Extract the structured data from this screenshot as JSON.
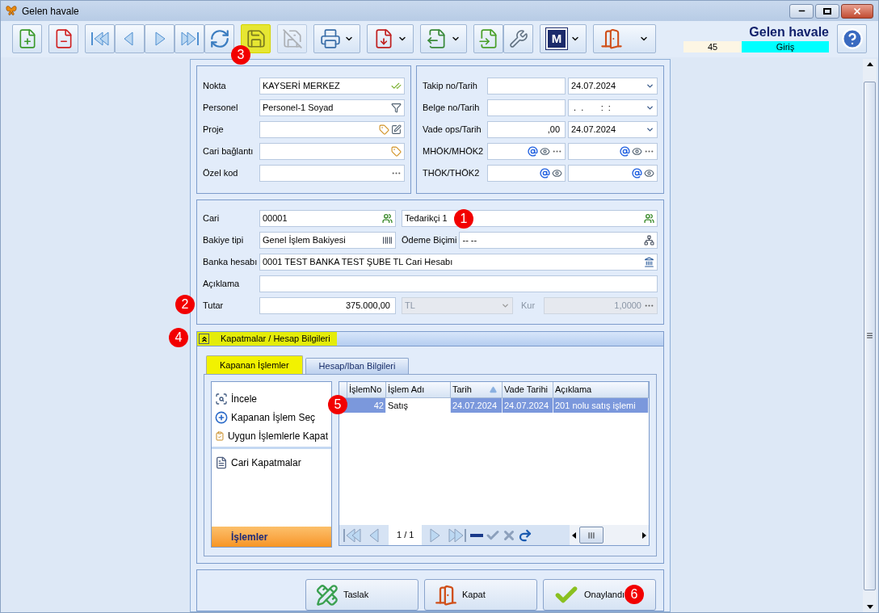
{
  "window": {
    "title": "Gelen havale"
  },
  "toolbar": [
    {
      "buttons": [
        {
          "kind": "new",
          "highlighted": false,
          "disabled": false,
          "dropdown": false
        }
      ]
    },
    {
      "buttons": [
        {
          "kind": "delete",
          "highlighted": false,
          "disabled": false,
          "dropdown": false
        }
      ]
    },
    {
      "buttons": [
        {
          "kind": "first",
          "highlighted": false,
          "disabled": false,
          "dropdown": false
        },
        {
          "kind": "prev",
          "highlighted": false,
          "disabled": false,
          "dropdown": false
        },
        {
          "kind": "next",
          "highlighted": false,
          "disabled": false,
          "dropdown": false
        },
        {
          "kind": "last",
          "highlighted": false,
          "disabled": false,
          "dropdown": false
        },
        {
          "kind": "refresh",
          "highlighted": false,
          "disabled": false,
          "dropdown": false
        }
      ]
    },
    {
      "buttons": [
        {
          "kind": "save",
          "highlighted": true,
          "disabled": false,
          "dropdown": false,
          "marker": "3"
        }
      ]
    },
    {
      "buttons": [
        {
          "kind": "cancel-save",
          "highlighted": false,
          "disabled": true,
          "dropdown": false
        }
      ]
    },
    {
      "buttons": [
        {
          "kind": "print",
          "highlighted": false,
          "disabled": false,
          "dropdown": true
        }
      ]
    },
    {
      "buttons": [
        {
          "kind": "pdf",
          "highlighted": false,
          "disabled": false,
          "dropdown": true
        }
      ]
    },
    {
      "buttons": [
        {
          "kind": "export",
          "highlighted": false,
          "disabled": false,
          "dropdown": true
        }
      ]
    },
    {
      "buttons": [
        {
          "kind": "import",
          "highlighted": false,
          "disabled": false,
          "dropdown": false
        },
        {
          "kind": "settings",
          "highlighted": false,
          "disabled": false,
          "dropdown": false
        }
      ]
    },
    {
      "buttons": [
        {
          "kind": "logo",
          "label": "M",
          "highlighted": false,
          "disabled": false,
          "dropdown": true
        }
      ]
    },
    {
      "buttons": [
        {
          "kind": "exit",
          "highlighted": false,
          "disabled": false,
          "dropdown": true
        }
      ]
    }
  ],
  "header": {
    "title": "Gelen havale",
    "number": "45",
    "direction": "Giriş"
  },
  "top_left": [
    {
      "label": "Nokta",
      "value": "KAYSERİ MERKEZ",
      "kind": "check"
    },
    {
      "label": "Personel",
      "value": "Personel-1 Soyad",
      "kind": "person"
    },
    {
      "label": "Proje",
      "kind": "tag-edit"
    },
    {
      "label": "Cari bağlantı",
      "kind": "tag"
    },
    {
      "label": "Özel kod",
      "kind": "more"
    }
  ],
  "top_right": [
    {
      "label": "Takip no/Tarih",
      "fields": [
        {
          "kind": "plain"
        },
        {
          "value": "24.07.2024",
          "kind": "date"
        }
      ]
    },
    {
      "label": "Belge no/Tarih",
      "fields": [
        {
          "kind": "plain"
        },
        {
          "value": " .  .       :  :",
          "kind": "date"
        }
      ]
    },
    {
      "label": "Vade ops/Tarih",
      "fields": [
        {
          "value": ",00",
          "kind": "amount"
        },
        {
          "value": "24.07.2024",
          "kind": "date"
        }
      ]
    },
    {
      "label": "MHÖK/MHÖK2",
      "fields": [
        {
          "kind": "at-more"
        },
        {
          "kind": "at-more"
        }
      ]
    },
    {
      "label": "THÖK/THÖK2",
      "fields": [
        {
          "kind": "at"
        },
        {
          "kind": "at"
        }
      ]
    }
  ],
  "main": [
    {
      "label": "Cari",
      "cells": [
        {
          "value": "00001",
          "kind": "people",
          "disabled": false
        },
        {
          "value": "Tedarikçi 1",
          "kind": "people",
          "disabled": false,
          "marker": "1"
        }
      ]
    },
    {
      "label": "Bakiye tipi",
      "cells": [
        {
          "value": "Genel İşlem Bakiyesi",
          "kind": "barcode",
          "disabled": false
        },
        {
          "kind": "label",
          "text": "Ödeme Biçimi",
          "disabled": false
        },
        {
          "value": "-- --",
          "kind": "tree",
          "disabled": false
        }
      ]
    },
    {
      "label": "Banka hesabı",
      "cells": [
        {
          "value": "0001 TEST BANKA TEST ŞUBE TL Cari Hesabı",
          "kind": "bank",
          "disabled": false
        }
      ]
    },
    {
      "label": "Açıklama",
      "cells": [
        {
          "kind": "plain",
          "disabled": false
        }
      ]
    },
    {
      "label": "Tutar",
      "marker": "2",
      "cells": [
        {
          "value": "375.000,00",
          "kind": "amount",
          "disabled": false
        },
        {
          "value": "TL",
          "kind": "combo",
          "disabled": true
        },
        {
          "kind": "label",
          "text": "Kur",
          "disabled": true
        },
        {
          "value": "1,0000",
          "kind": "amount-more",
          "disabled": true
        }
      ]
    }
  ],
  "section": {
    "title": "Kapatmalar / Hesap Bilgileri",
    "expanded": true,
    "marker": "4"
  },
  "tabs": [
    {
      "label": "Kapanan İşlemler",
      "selected": true
    },
    {
      "label": "Hesap/Iban Bilgileri",
      "selected": false
    }
  ],
  "actions": {
    "groups": [
      {
        "items": [
          {
            "label": "İncele",
            "kind": "inspect"
          },
          {
            "label": "Kapanan İşlem Seç",
            "kind": "add"
          },
          {
            "label": "Uygun İşlemlerle Kapat",
            "kind": "clipboard"
          }
        ]
      },
      {
        "items": [
          {
            "label": "Cari Kapatmalar",
            "kind": "document"
          }
        ]
      }
    ],
    "footer": "İşlemler"
  },
  "grid": {
    "columns": [
      {
        "label": "İşlemNo",
        "sorted": false
      },
      {
        "label": "İşlem Adı",
        "sorted": false
      },
      {
        "label": "Tarih",
        "sorted": true
      },
      {
        "label": "Vade Tarihi",
        "sorted": false
      },
      {
        "label": "Açıklama",
        "sorted": false
      }
    ],
    "rows": [
      {
        "selected": true,
        "marker": "5",
        "cells": [
          {
            "text": "42",
            "focused": false
          },
          {
            "text": "Satış",
            "focused": true
          },
          {
            "text": "24.07.2024",
            "focused": false
          },
          {
            "text": "24.07.2024",
            "focused": false
          },
          {
            "text": "201 nolu satış işlemi",
            "focused": false
          }
        ]
      }
    ],
    "pager": "1 / 1"
  },
  "buttons": [
    {
      "label": "Taslak",
      "kind": "draft"
    },
    {
      "label": "Kapat",
      "kind": "exit"
    },
    {
      "label": "Onaylandı",
      "kind": "approve",
      "marker": "6"
    }
  ]
}
